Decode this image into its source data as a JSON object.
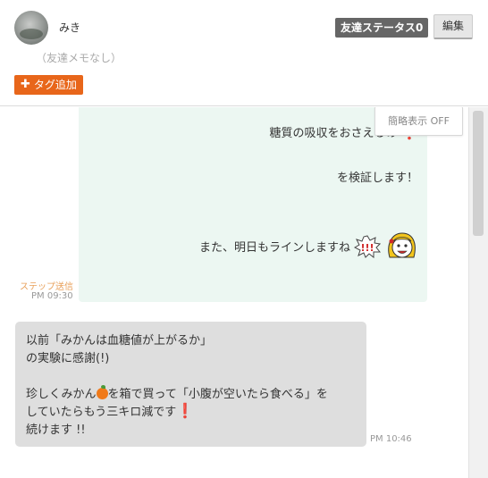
{
  "header": {
    "user_name": "みき",
    "memo": "（友達メモなし）",
    "tag_add_label": "タグ追加",
    "status_badge": "友達ステータス0",
    "edit_label": "編集"
  },
  "chat": {
    "compact_toggle_label": "簡略表示 OFF",
    "outgoing": {
      "line1": "糖質の吸収をおさえるの",
      "line2": "を検証します！",
      "line3": "また、明日もラインしますね",
      "step_label": "ステップ送信",
      "time": "PM 09:30"
    },
    "incoming": {
      "line1": "以前「みかんは血糖値が上がるか」",
      "line2": "の実験に感謝(!)",
      "line3_a": "珍しくみかん",
      "line3_b": "を箱で買って「小腹が空いたら食べる」を",
      "line4": "していたらもう三キロ減です",
      "line5": "続けます !!",
      "time": "PM 10:46"
    }
  },
  "icons": {
    "avatar": "user-avatar",
    "plus": "plus-icon",
    "exclamation": "red-exclamation-icon",
    "burst": "exclamation-burst-sticker",
    "face": "smiling-girl-sticker",
    "orange": "mandarin-orange-emoji"
  },
  "colors": {
    "accent": "#e8661a",
    "outgoing_bubble": "#ecf7f2",
    "incoming_bubble": "#dedede",
    "status_badge": "#666666",
    "step_label": "#e8a05a"
  }
}
